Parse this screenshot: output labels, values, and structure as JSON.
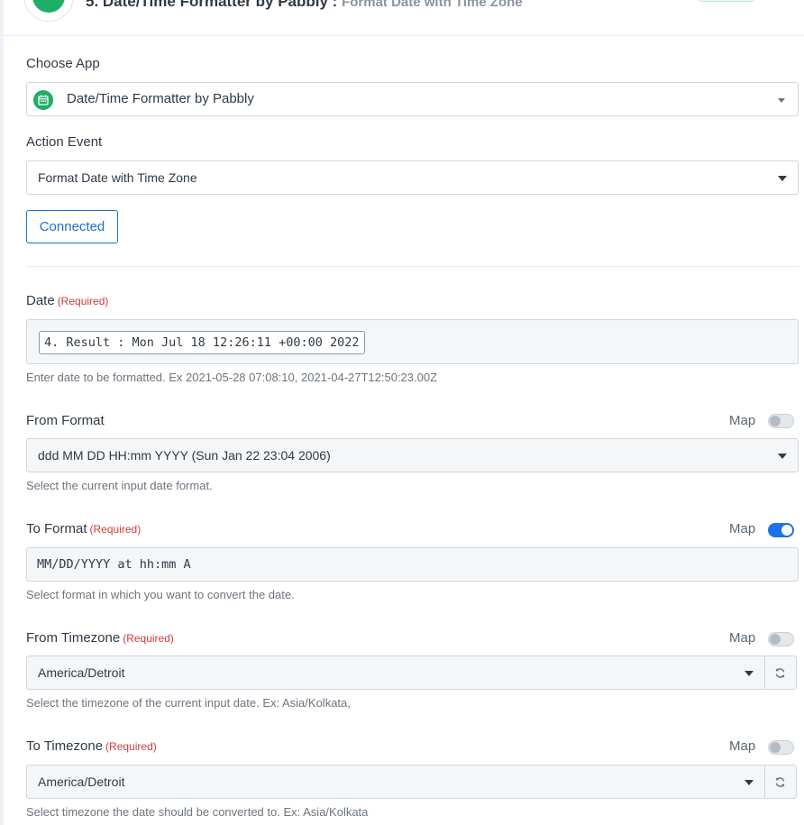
{
  "header": {
    "step_title": "5. Date/Time Formatter by Pabbly :",
    "step_event": "Format Date with Time Zone"
  },
  "choose_app": {
    "label": "Choose App",
    "value": "Date/Time Formatter by Pabbly",
    "icon": "calendar-icon"
  },
  "action_event": {
    "label": "Action Event",
    "value": "Format Date with Time Zone"
  },
  "connection": {
    "button_label": "Connected"
  },
  "date_field": {
    "label": "Date",
    "required": "(Required)",
    "mapped_value": "4. Result : Mon Jul 18 12:26:11 +00:00 2022",
    "help": "Enter date to be formatted. Ex 2021-05-28 07:08:10, 2021-04-27T12:50:23.00Z"
  },
  "from_format": {
    "label": "From Format",
    "map_label": "Map",
    "map_enabled": false,
    "value": "ddd MM DD HH:mm YYYY (Sun Jan 22 23:04 2006)",
    "help": "Select the current input date format."
  },
  "to_format": {
    "label": "To Format",
    "required": "(Required)",
    "map_label": "Map",
    "map_enabled": true,
    "value": "MM/DD/YYYY at hh:mm A",
    "help": "Select format in which you want to convert the date."
  },
  "from_timezone": {
    "label": "From Timezone",
    "required": "(Required)",
    "map_label": "Map",
    "map_enabled": false,
    "value": "America/Detroit",
    "help": "Select the timezone of the current input date. Ex: Asia/Kolkata,"
  },
  "to_timezone": {
    "label": "To Timezone",
    "required": "(Required)",
    "map_label": "Map",
    "map_enabled": false,
    "value": "America/Detroit",
    "help": "Select timezone the date should be converted to. Ex: Asia/Kolkata"
  },
  "colors": {
    "accent": "#1a73c9",
    "app_green": "#1eae67",
    "required_red": "#cf3b3b"
  }
}
